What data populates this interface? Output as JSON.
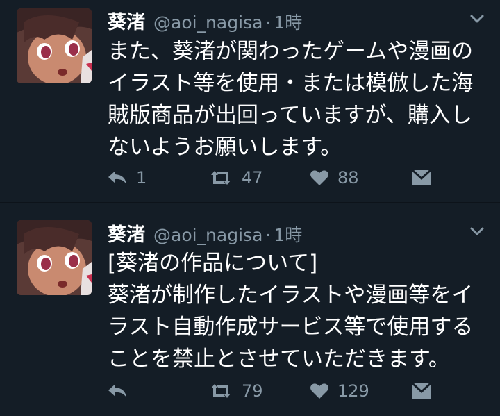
{
  "tweets": [
    {
      "name": "葵渚",
      "handle": "@aoi_nagisa",
      "sep": "·",
      "time": "1時",
      "lines": [
        "また、葵渚が関わったゲームや漫画の",
        "イラスト等を使用・または模倣した海",
        "賊版商品が出回っていますが、購入し",
        "ないようお願いします。"
      ],
      "reply_count": "1",
      "retweet_count": "47",
      "like_count": "88"
    },
    {
      "name": "葵渚",
      "handle": "@aoi_nagisa",
      "sep": "·",
      "time": "1時",
      "lines": [
        "[葵渚の作品について]",
        "葵渚が制作したイラストや漫画等をイ",
        "ラスト自動作成サービス等で使用する",
        "ことを禁止とさせていただきます。"
      ],
      "reply_count": "",
      "retweet_count": "79",
      "like_count": "129"
    }
  ],
  "colors": {
    "background": "#141d26",
    "text": "#ffffff",
    "muted": "#8899a6",
    "divider": "#0d131a"
  },
  "icons": [
    "reply-icon",
    "retweet-icon",
    "heart-icon",
    "direct-message-icon",
    "chevron-down-icon",
    "avatar"
  ]
}
